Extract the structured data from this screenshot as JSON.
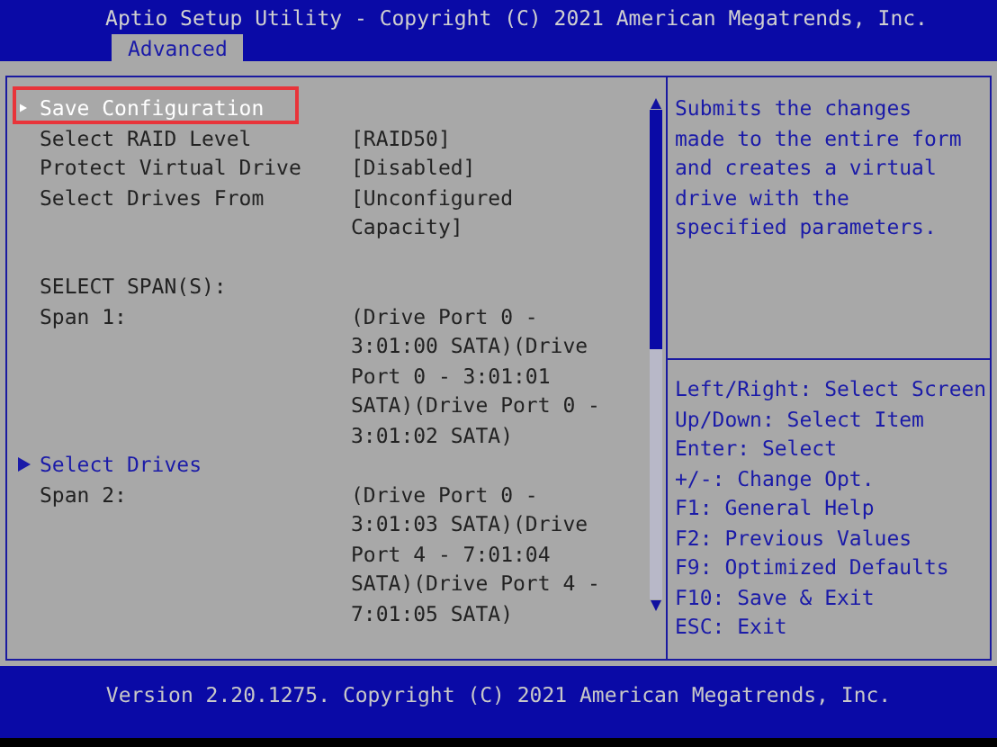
{
  "window": {
    "title": "Aptio Setup Utility - Copyright (C) 2021 American Megatrends, Inc."
  },
  "tabs": [
    {
      "label": "Advanced",
      "selected": true
    }
  ],
  "rows": [
    {
      "kind": "action",
      "label": "Save Configuration",
      "selected": true
    },
    {
      "kind": "setting",
      "label": "Select RAID Level",
      "value": "[RAID50]",
      "selected": false
    },
    {
      "kind": "setting",
      "label": "Protect Virtual Drive",
      "value": "[Disabled]",
      "selected": false
    },
    {
      "kind": "setting",
      "label": "Select Drives From",
      "value": "[Unconfigured Capacity]",
      "selected": false
    },
    {
      "kind": "blank"
    },
    {
      "kind": "info",
      "label": "SELECT SPAN(S):"
    },
    {
      "kind": "info",
      "label": "Span 1:",
      "value": "(Drive Port 0 - 3:01:00 SATA)(Drive Port 0 - 3:01:01 SATA)(Drive Port 0 - 3:01:02 SATA)"
    },
    {
      "kind": "submenu",
      "label": "Select Drives",
      "selected": false
    },
    {
      "kind": "info",
      "label": "Span 2:",
      "value": "(Drive Port 0 - 3:01:03 SATA)(Drive Port 4 - 7:01:04 SATA)(Drive Port 4 - 7:01:05 SATA)"
    }
  ],
  "help": "Submits the changes made to the entire form and creates a virtual drive with the specified parameters.",
  "keys": [
    "Left/Right: Select Screen",
    "Up/Down: Select Item",
    "Enter: Select",
    "+/-: Change Opt.",
    "F1: General Help",
    "F2: Previous Values",
    "F9: Optimized Defaults",
    "F10: Save & Exit",
    "ESC: Exit"
  ],
  "footer": "Version 2.20.1275. Copyright (C) 2021 American Megatrends, Inc."
}
